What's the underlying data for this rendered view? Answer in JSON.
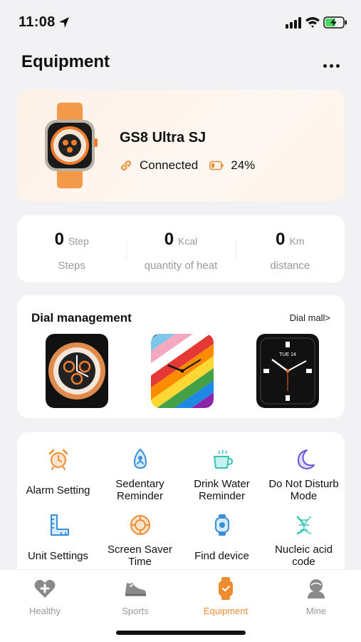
{
  "status_bar": {
    "time": "11:08",
    "icons": [
      "location-arrow-icon",
      "cellular-signal-icon",
      "wifi-icon",
      "battery-charging-icon"
    ]
  },
  "header": {
    "title": "Equipment",
    "more_icon": "more-dots-icon"
  },
  "device": {
    "name": "GS8 Ultra SJ",
    "connection_status": "Connected",
    "battery": "24%",
    "image": "orange-strap-smartwatch"
  },
  "stats": [
    {
      "value": "0",
      "unit": "Step",
      "label": "Steps"
    },
    {
      "value": "0",
      "unit": "Kcal",
      "label": "quantity of heat"
    },
    {
      "value": "0",
      "unit": "Km",
      "label": "distance"
    }
  ],
  "dial_management": {
    "title": "Dial management",
    "mall_link": "Dial  mall>",
    "dials": [
      {
        "name": "orange-sport-dial"
      },
      {
        "name": "rainbow-stripe-dial"
      },
      {
        "name": "black-classic-dial",
        "date_text": "TUE 14"
      }
    ]
  },
  "functions": [
    {
      "label": "Alarm Setting",
      "icon": "alarm-clock-icon"
    },
    {
      "label": "Sedentary Reminder",
      "icon": "sedentary-icon"
    },
    {
      "label": "Drink Water Reminder",
      "icon": "water-cup-icon"
    },
    {
      "label": "Do Not Disturb Mode",
      "icon": "moon-icon"
    },
    {
      "label": "Unit Settings",
      "icon": "ruler-icon"
    },
    {
      "label": "Screen Saver Time",
      "icon": "screen-saver-icon"
    },
    {
      "label": "Find device",
      "icon": "watch-find-icon"
    },
    {
      "label": "Nucleic acid code",
      "icon": "dna-icon"
    }
  ],
  "nav": [
    {
      "label": "Healthy",
      "icon": "heart-plus-icon",
      "active": false
    },
    {
      "label": "Sports",
      "icon": "sneaker-icon",
      "active": false
    },
    {
      "label": "Equipment",
      "icon": "watch-icon",
      "active": true
    },
    {
      "label": "Mine",
      "icon": "user-icon",
      "active": false
    }
  ],
  "colors": {
    "accent": "#ee8b2f",
    "inactive": "#999999",
    "background": "#f2f2f4"
  }
}
